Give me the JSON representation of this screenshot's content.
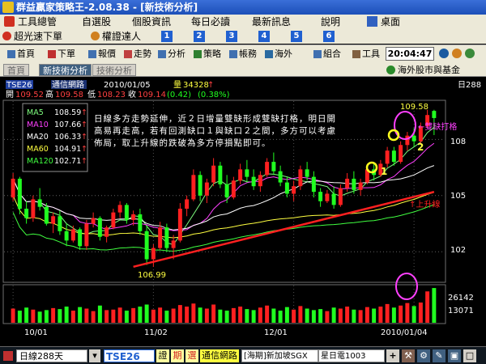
{
  "window": {
    "title": "群益贏家策略王-2.08.38 - [新技術分析]"
  },
  "menu": {
    "items": [
      "工具總管",
      "自選股",
      "個股資訊",
      "每日必讀",
      "最新訊息",
      "說明",
      "桌面"
    ]
  },
  "menu2": {
    "items": [
      "超光速下單",
      "權證達人"
    ],
    "numbers": [
      "1",
      "2",
      "3",
      "4",
      "5",
      "6"
    ]
  },
  "toolbar": {
    "buttons": [
      "首頁",
      "下單",
      "報價",
      "走勢",
      "分析",
      "策略",
      "帳務",
      "海外",
      "組合",
      "工具"
    ],
    "clock": "20:04:47"
  },
  "tabs": {
    "items": [
      "首頁",
      "新技術分析",
      "技術分析"
    ],
    "overseas": "海外股市與基金"
  },
  "quote": {
    "symbol": "TSE26",
    "name": "通信網路",
    "date": "2010/01/05",
    "volume_label": "量",
    "volume": "34328",
    "up_arrow": "↑",
    "open_label": "開",
    "open": "109.52",
    "high_label": "高",
    "high": "109.58",
    "low_label": "低",
    "low": "108.23",
    "close_label": "收",
    "close": "109.14",
    "change": "(0.42)",
    "change_pct": "(0.38%)",
    "period_right": "日288"
  },
  "ma_legend": [
    {
      "name": "MA5",
      "value": "108.59",
      "arrow": "↑",
      "color": "#7fff7f"
    },
    {
      "name": "MA10",
      "value": "107.66",
      "arrow": "↑",
      "color": "#ff40ff"
    },
    {
      "name": "MA20",
      "value": "106.33",
      "arrow": "↑",
      "color": "#ffffff"
    },
    {
      "name": "MA60",
      "value": "104.91",
      "arrow": "↑",
      "color": "#ffff40"
    },
    {
      "name": "MA120",
      "value": "102.71",
      "arrow": "↑",
      "color": "#40ff40"
    }
  ],
  "annotation": {
    "text": "日線多方走勢延伸，近２日增量雙缺形成雙缺打格，明日開高易再走高，若有回測缺口１與缺口２之間，多方可以考慮佈局，取上升線的跌破為多方停損點即可。",
    "double_gap": "←雙缺打格",
    "uptrend": "↑上升線",
    "gap1": "1",
    "gap2": "2",
    "high_mark": "109.58",
    "low_mark": "106.99"
  },
  "y_axis": {
    "ticks": [
      "108",
      "105",
      "102"
    ],
    "volume_ticks": [
      "26142",
      "13071"
    ]
  },
  "x_axis": {
    "ticks": [
      "10/01",
      "11/02",
      "12/01",
      "2010/01/04"
    ]
  },
  "status": {
    "period": "日線288天",
    "symbol": "TSE26",
    "btn1": "證",
    "btn2": "期",
    "btn3": "選",
    "name": "通信網路",
    "ticker1": "[海期]新加坡SGX",
    "ticker2": "星日電1003"
  },
  "chart_data": {
    "type": "candlestick",
    "x": [
      "10/01",
      "11/02",
      "12/01",
      "2010/01/04"
    ],
    "ylim": [
      100.5,
      110.0
    ],
    "candles": [
      [
        104.9,
        106.2,
        104.7,
        105.9
      ],
      [
        105.9,
        106.0,
        104.0,
        104.3
      ],
      [
        104.3,
        104.7,
        103.5,
        103.8
      ],
      [
        103.8,
        105.0,
        103.6,
        104.8
      ],
      [
        104.8,
        105.4,
        104.2,
        104.4
      ],
      [
        104.4,
        104.6,
        103.4,
        103.5
      ],
      [
        103.5,
        104.1,
        103.0,
        103.9
      ],
      [
        103.9,
        104.2,
        102.9,
        103.1
      ],
      [
        103.1,
        103.5,
        102.3,
        102.6
      ],
      [
        102.6,
        103.4,
        102.5,
        103.2
      ],
      [
        103.2,
        103.3,
        102.1,
        102.3
      ],
      [
        102.3,
        103.7,
        102.1,
        103.5
      ],
      [
        103.5,
        104.1,
        103.3,
        103.8
      ],
      [
        103.8,
        103.9,
        102.6,
        102.8
      ],
      [
        102.8,
        103.4,
        102.5,
        103.3
      ],
      [
        103.3,
        104.3,
        103.2,
        104.1
      ],
      [
        104.1,
        104.7,
        103.8,
        104.5
      ],
      [
        104.5,
        104.6,
        103.5,
        103.7
      ],
      [
        103.7,
        104.2,
        103.4,
        104.0
      ],
      [
        104.0,
        104.3,
        102.9,
        103.1
      ],
      [
        103.1,
        103.4,
        101.3,
        101.6
      ],
      [
        101.6,
        102.4,
        101.2,
        102.2
      ],
      [
        102.2,
        103.6,
        102.1,
        103.3
      ],
      [
        103.3,
        103.5,
        102.0,
        102.2
      ],
      [
        102.2,
        102.9,
        101.6,
        102.6
      ],
      [
        102.6,
        104.6,
        102.5,
        104.3
      ],
      [
        104.3,
        105.0,
        103.9,
        104.8
      ],
      [
        104.8,
        106.4,
        104.7,
        106.1
      ],
      [
        106.1,
        106.3,
        104.7,
        105.0
      ],
      [
        105.0,
        105.9,
        104.6,
        105.7
      ],
      [
        105.7,
        107.0,
        105.5,
        106.6
      ],
      [
        106.6,
        106.8,
        105.4,
        105.6
      ],
      [
        105.6,
        106.1,
        104.6,
        104.9
      ],
      [
        104.9,
        106.0,
        104.8,
        105.8
      ],
      [
        105.8,
        106.7,
        105.6,
        106.4
      ],
      [
        106.4,
        106.9,
        105.7,
        106.0
      ],
      [
        106.0,
        106.4,
        105.3,
        105.5
      ],
      [
        105.5,
        106.3,
        105.2,
        106.1
      ],
      [
        106.1,
        107.0,
        106.0,
        106.8
      ],
      [
        106.8,
        107.3,
        106.1,
        106.3
      ],
      [
        106.3,
        106.6,
        105.5,
        105.7
      ],
      [
        105.7,
        106.0,
        104.9,
        105.1
      ],
      [
        105.1,
        105.8,
        104.7,
        105.5
      ],
      [
        105.5,
        106.6,
        105.3,
        106.4
      ],
      [
        106.4,
        106.8,
        105.8,
        106.0
      ],
      [
        106.0,
        106.3,
        104.9,
        105.2
      ],
      [
        105.2,
        105.4,
        104.4,
        104.7
      ],
      [
        104.7,
        105.3,
        104.6,
        105.1
      ],
      [
        105.1,
        105.5,
        104.3,
        104.5
      ],
      [
        104.5,
        105.6,
        104.4,
        105.4
      ],
      [
        105.4,
        106.2,
        105.2,
        105.9
      ],
      [
        105.9,
        106.3,
        105.1,
        105.3
      ],
      [
        105.3,
        105.9,
        105.0,
        105.7
      ],
      [
        105.7,
        106.6,
        105.6,
        106.4
      ],
      [
        106.4,
        106.7,
        105.8,
        106.1
      ],
      [
        106.1,
        106.9,
        106.0,
        106.7
      ],
      [
        106.7,
        107.6,
        106.5,
        107.4
      ],
      [
        107.4,
        107.6,
        106.6,
        106.8
      ],
      [
        106.8,
        107.9,
        106.7,
        107.7
      ],
      [
        107.7,
        108.4,
        107.4,
        108.2
      ],
      [
        108.2,
        108.6,
        107.6,
        107.9
      ],
      [
        107.9,
        108.9,
        107.8,
        108.7
      ],
      [
        108.7,
        109.58,
        108.6,
        109.3
      ],
      [
        109.52,
        109.58,
        108.23,
        109.14
      ]
    ],
    "volumes": [
      14000,
      12000,
      15000,
      13000,
      11000,
      12500,
      14500,
      13500,
      16000,
      12000,
      15500,
      14000,
      11500,
      17000,
      12500,
      13000,
      15000,
      12000,
      14500,
      16000,
      18000,
      13000,
      15000,
      12000,
      14000,
      17500,
      16000,
      19000,
      15000,
      14000,
      18000,
      13000,
      12000,
      14500,
      16000,
      13500,
      12500,
      15000,
      17000,
      14000,
      12000,
      15500,
      13000,
      16500,
      14000,
      12500,
      13500,
      11500,
      15000,
      14000,
      16000,
      13000,
      12500,
      15500,
      14000,
      16000,
      18500,
      15000,
      17000,
      19500,
      16500,
      20000,
      31000,
      34328
    ],
    "volume_ylim": [
      0,
      36000
    ],
    "ma_series": [
      {
        "name": "MA5",
        "color": "#7fff7f"
      },
      {
        "name": "MA10",
        "color": "#ff40ff"
      },
      {
        "name": "MA20",
        "color": "#ffffff"
      },
      {
        "name": "MA60",
        "color": "#ffff40"
      },
      {
        "name": "MA120",
        "color": "#40ff40"
      }
    ],
    "trendline": {
      "from": [
        18,
        101.2
      ],
      "to": [
        63,
        105.2
      ]
    },
    "up_color": "#ff2020",
    "down_color": "#20ff20"
  }
}
